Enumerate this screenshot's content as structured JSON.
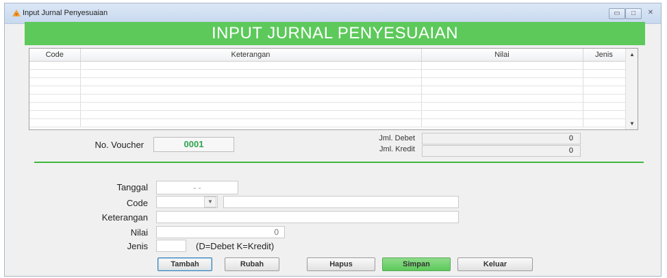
{
  "window": {
    "title": "Input Jurnal Penyesuaian"
  },
  "banner": {
    "title": "INPUT JURNAL PENYESUAIAN"
  },
  "grid": {
    "columns": [
      "Code",
      "Keterangan",
      "Nilai",
      "Jenis"
    ],
    "rows": [
      [
        "",
        "",
        "",
        ""
      ],
      [
        "",
        "",
        "",
        ""
      ],
      [
        "",
        "",
        "",
        ""
      ],
      [
        "",
        "",
        "",
        ""
      ],
      [
        "",
        "",
        "",
        ""
      ],
      [
        "",
        "",
        "",
        ""
      ],
      [
        "",
        "",
        "",
        ""
      ],
      [
        "",
        "",
        "",
        ""
      ]
    ]
  },
  "voucher": {
    "label": "No. Voucher",
    "value": "0001"
  },
  "totals": {
    "debet_label": "Jml. Debet",
    "debet_value": "0",
    "kredit_label": "Jml. Kredit",
    "kredit_value": "0"
  },
  "form": {
    "tanggal_label": "Tanggal",
    "tanggal_value": "- -",
    "code_label": "Code",
    "code_value": "",
    "code_desc": "",
    "keterangan_label": "Keterangan",
    "keterangan_value": "",
    "nilai_label": "Nilai",
    "nilai_value": "0",
    "jenis_label": "Jenis",
    "jenis_value": "",
    "jenis_hint": "(D=Debet    K=Kredit)"
  },
  "buttons": {
    "tambah": "Tambah",
    "rubah": "Rubah",
    "hapus": "Hapus",
    "simpan": "Simpan",
    "keluar": "Keluar"
  },
  "colors": {
    "accent_green": "#5cc95a",
    "divider_green": "#3cb83a",
    "voucher_text": "#2ea44f"
  }
}
